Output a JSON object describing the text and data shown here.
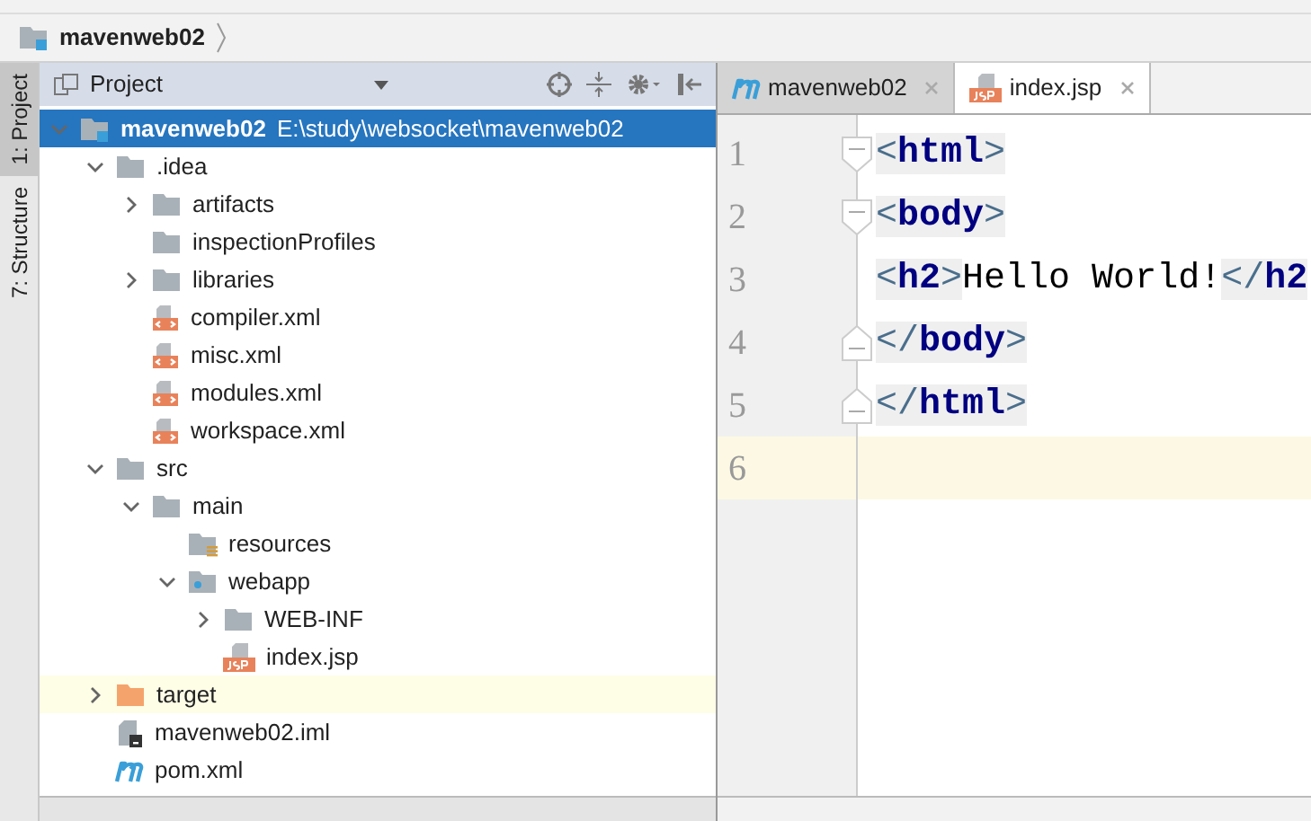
{
  "breadcrumb": {
    "project": "mavenweb02"
  },
  "tool_strip": [
    {
      "label": "1: Project",
      "selected": true
    },
    {
      "label": "7: Structure",
      "selected": false
    }
  ],
  "project_panel": {
    "title": "Project",
    "tree": [
      {
        "name": "mavenweb02",
        "path": "E:\\study\\websocket\\mavenweb02",
        "kind": "module",
        "expanded": true,
        "selected": true,
        "children": [
          {
            "name": ".idea",
            "kind": "folder",
            "expanded": true,
            "children": [
              {
                "name": "artifacts",
                "kind": "folder",
                "expanded": false
              },
              {
                "name": "inspectionProfiles",
                "kind": "folder"
              },
              {
                "name": "libraries",
                "kind": "folder",
                "expanded": false
              },
              {
                "name": "compiler.xml",
                "kind": "xml"
              },
              {
                "name": "misc.xml",
                "kind": "xml"
              },
              {
                "name": "modules.xml",
                "kind": "xml"
              },
              {
                "name": "workspace.xml",
                "kind": "xml"
              }
            ]
          },
          {
            "name": "src",
            "kind": "folder",
            "expanded": true,
            "children": [
              {
                "name": "main",
                "kind": "folder",
                "expanded": true,
                "children": [
                  {
                    "name": "resources",
                    "kind": "resources"
                  },
                  {
                    "name": "webapp",
                    "kind": "web",
                    "expanded": true,
                    "children": [
                      {
                        "name": "WEB-INF",
                        "kind": "folder",
                        "expanded": false
                      },
                      {
                        "name": "index.jsp",
                        "kind": "jsp"
                      }
                    ]
                  }
                ]
              }
            ]
          },
          {
            "name": "target",
            "kind": "excluded",
            "expanded": false,
            "highlighted": true
          },
          {
            "name": "mavenweb02.iml",
            "kind": "iml"
          },
          {
            "name": "pom.xml",
            "kind": "maven"
          }
        ]
      }
    ]
  },
  "editor": {
    "tabs": [
      {
        "label": "mavenweb02",
        "kind": "maven",
        "selected": false
      },
      {
        "label": "index.jsp",
        "kind": "jsp",
        "selected": true
      }
    ],
    "lines": [
      {
        "number": "1",
        "fold_start": true,
        "fold_end": false,
        "current": false,
        "tokens": [
          {
            "kind": "bracket",
            "text": "<"
          },
          {
            "kind": "tag",
            "text": "html"
          },
          {
            "kind": "bracket",
            "text": ">"
          }
        ]
      },
      {
        "number": "2",
        "fold_start": true,
        "fold_end": false,
        "current": false,
        "tokens": [
          {
            "kind": "bracket",
            "text": "<"
          },
          {
            "kind": "tag",
            "text": "body"
          },
          {
            "kind": "bracket",
            "text": ">"
          }
        ]
      },
      {
        "number": "3",
        "fold_start": false,
        "fold_end": false,
        "current": false,
        "tokens": [
          {
            "kind": "bracket",
            "text": "<"
          },
          {
            "kind": "tag",
            "text": "h2"
          },
          {
            "kind": "bracket",
            "text": ">"
          },
          {
            "kind": "text",
            "text": "Hello World!"
          },
          {
            "kind": "bracket",
            "text": "</"
          },
          {
            "kind": "tag",
            "text": "h2"
          }
        ]
      },
      {
        "number": "4",
        "fold_start": false,
        "fold_end": true,
        "current": false,
        "tokens": [
          {
            "kind": "bracket",
            "text": "</"
          },
          {
            "kind": "tag",
            "text": "body"
          },
          {
            "kind": "bracket",
            "text": ">"
          }
        ]
      },
      {
        "number": "5",
        "fold_start": false,
        "fold_end": true,
        "current": false,
        "tokens": [
          {
            "kind": "bracket",
            "text": "</"
          },
          {
            "kind": "tag",
            "text": "html"
          },
          {
            "kind": "bracket",
            "text": ">"
          }
        ]
      },
      {
        "number": "6",
        "fold_start": false,
        "fold_end": false,
        "current": true
      }
    ]
  }
}
